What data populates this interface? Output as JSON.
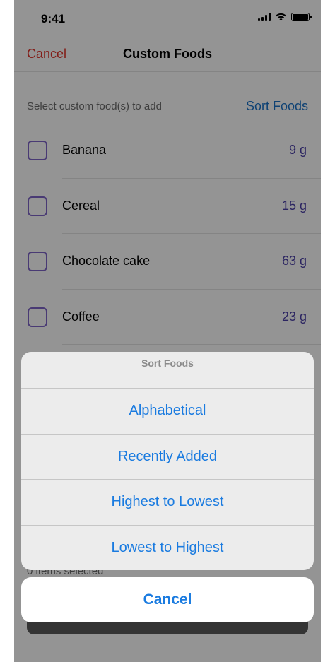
{
  "status_bar": {
    "time": "9:41",
    "icons": [
      "signal-icon",
      "wifi-icon",
      "battery-icon"
    ]
  },
  "nav": {
    "cancel_label": "Cancel",
    "title": "Custom Foods"
  },
  "section": {
    "label": "Select custom food(s) to add",
    "sort_label": "Sort Foods"
  },
  "foods": [
    {
      "name": "Banana",
      "amount": "9 g"
    },
    {
      "name": "Cereal",
      "amount": "15 g"
    },
    {
      "name": "Chocolate cake",
      "amount": "63 g"
    },
    {
      "name": "Coffee",
      "amount": "23 g"
    }
  ],
  "footer": {
    "items_selected": "0 items selected"
  },
  "action_sheet": {
    "title": "Sort Foods",
    "options": [
      "Alphabetical",
      "Recently Added",
      "Highest to Lowest",
      "Lowest to Highest"
    ],
    "cancel_label": "Cancel"
  },
  "colors": {
    "accent": "#1a7be0",
    "destructive": "#e0352b",
    "checkbox": "#7e64c8",
    "amount": "#4a3fa8"
  }
}
